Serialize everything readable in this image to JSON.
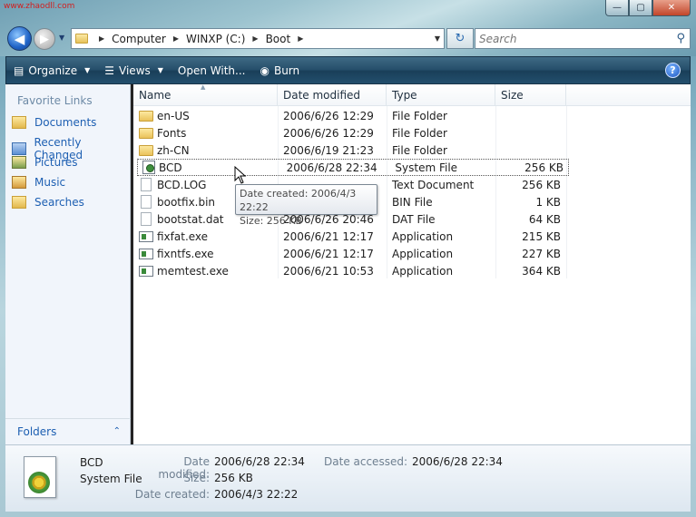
{
  "watermark": "www.zhaodll.com",
  "window": {
    "minimize_glyph": "—",
    "maximize_glyph": "▢",
    "close_glyph": "✕"
  },
  "nav": {
    "back_glyph": "◀",
    "forward_glyph": "▶",
    "breadcrumbs": [
      "Computer",
      "WINXP (C:)",
      "Boot"
    ],
    "search_placeholder": "Search",
    "refresh_glyph": "↻",
    "search_glyph": "⚲"
  },
  "toolbar": {
    "organize": "Organize",
    "views": "Views",
    "open_with": "Open With...",
    "burn": "Burn",
    "help": "?"
  },
  "sidebar": {
    "title": "Favorite Links",
    "items": [
      {
        "label": "Documents",
        "icon": "documents-icon"
      },
      {
        "label": "Recently Changed",
        "icon": "recently-changed-icon"
      },
      {
        "label": "Pictures",
        "icon": "pictures-icon"
      },
      {
        "label": "Music",
        "icon": "music-icon"
      },
      {
        "label": "Searches",
        "icon": "searches-icon"
      }
    ],
    "folders_label": "Folders",
    "folders_chevron": "⌃"
  },
  "columns": {
    "name": "Name",
    "date": "Date modified",
    "type": "Type",
    "size": "Size"
  },
  "files": [
    {
      "name": "en-US",
      "date": "2006/6/26 12:29",
      "type": "File Folder",
      "size": "",
      "icon": "folder"
    },
    {
      "name": "Fonts",
      "date": "2006/6/26 12:29",
      "type": "File Folder",
      "size": "",
      "icon": "folder"
    },
    {
      "name": "zh-CN",
      "date": "2006/6/19 21:23",
      "type": "File Folder",
      "size": "",
      "icon": "folder"
    },
    {
      "name": "BCD",
      "date": "2006/6/28 22:34",
      "type": "System File",
      "size": "256 KB",
      "icon": "sys"
    },
    {
      "name": "BCD.LOG",
      "date": "",
      "type": "Text Document",
      "size": "256 KB",
      "icon": "doc"
    },
    {
      "name": "bootfix.bin",
      "date": "",
      "type": "BIN File",
      "size": "1 KB",
      "icon": "doc"
    },
    {
      "name": "bootstat.dat",
      "date": "2006/6/26 20:46",
      "type": "DAT File",
      "size": "64 KB",
      "icon": "doc"
    },
    {
      "name": "fixfat.exe",
      "date": "2006/6/21 12:17",
      "type": "Application",
      "size": "215 KB",
      "icon": "exe"
    },
    {
      "name": "fixntfs.exe",
      "date": "2006/6/21 12:17",
      "type": "Application",
      "size": "227 KB",
      "icon": "exe"
    },
    {
      "name": "memtest.exe",
      "date": "2006/6/21 10:53",
      "type": "Application",
      "size": "364 KB",
      "icon": "exe"
    }
  ],
  "tooltip": {
    "line1": "Date created: 2006/4/3 22:22",
    "line2": "Size: 256 KB"
  },
  "details": {
    "name": "BCD",
    "type": "System File",
    "date_modified_label": "Date modified:",
    "date_modified": "2006/6/28 22:34",
    "size_label": "Size:",
    "size": "256 KB",
    "date_created_label": "Date created:",
    "date_created": "2006/4/3 22:22",
    "date_accessed_label": "Date accessed:",
    "date_accessed": "2006/6/28 22:34"
  }
}
